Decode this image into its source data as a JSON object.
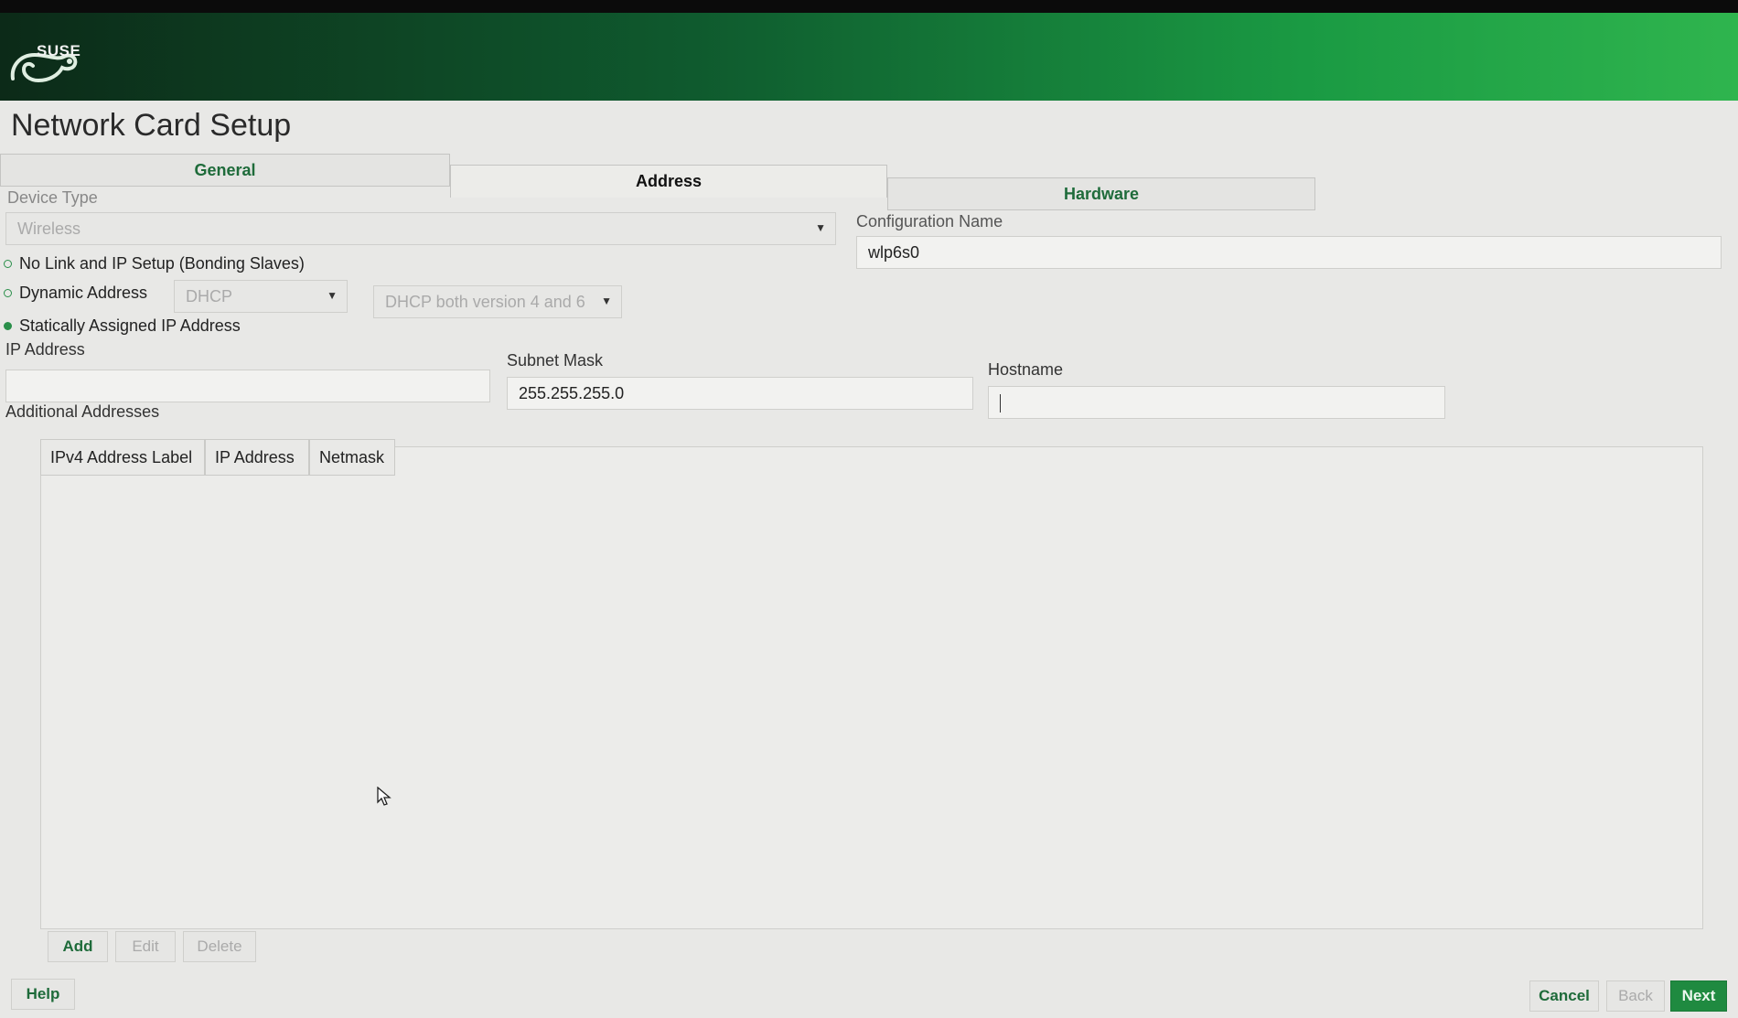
{
  "brand": {
    "logo_text": "SUSE"
  },
  "page": {
    "title": "Network Card Setup"
  },
  "tabs": [
    {
      "label": "General"
    },
    {
      "label": "Address"
    },
    {
      "label": "Hardware"
    }
  ],
  "device_type": {
    "label": "Device Type",
    "value": "Wireless"
  },
  "config_name": {
    "label": "Configuration Name",
    "value": "wlp6s0"
  },
  "radios": {
    "no_link": "No Link and IP Setup (Bonding Slaves)",
    "dynamic": "Dynamic Address",
    "static": "Statically Assigned IP Address"
  },
  "dynamic_options": {
    "method": "DHCP",
    "version": "DHCP both version 4 and 6"
  },
  "static": {
    "ip_label": "IP Address",
    "ip_value": "",
    "mask_label": "Subnet Mask",
    "mask_value": "255.255.255.0",
    "host_label": "Hostname",
    "host_value": ""
  },
  "additional": {
    "label": "Additional Addresses",
    "columns": [
      "IPv4 Address Label",
      "IP Address",
      "Netmask"
    ],
    "add": "Add",
    "edit": "Edit",
    "delete": "Delete"
  },
  "footer": {
    "help": "Help",
    "cancel": "Cancel",
    "back": "Back",
    "next": "Next"
  },
  "colors": {
    "accent": "#1f8a40",
    "tab_text": "#1e6b3a"
  }
}
